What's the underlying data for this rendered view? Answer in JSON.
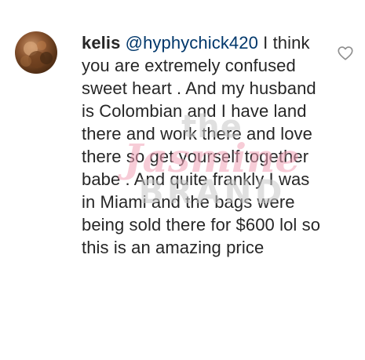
{
  "comment": {
    "username": "kelis",
    "mention": "@hyphychick420",
    "text": " I think you are extremely confused sweet heart . And my husband is Colombian and I have land there and work there and love there so get yourself together babe . And quite frankly I was in Miami and the bags were being sold there for $600 lol so this is an amazing price",
    "like_icon": "heart-outline-icon",
    "avatar_icon": "profile-photo"
  },
  "watermark": {
    "line1": "the",
    "line2": "Jasmine",
    "line3": "BRAND"
  },
  "colors": {
    "text": "#262626",
    "mention": "#00376b",
    "watermark_pink": "#f2a3b8",
    "watermark_gray": "#c8c8c8",
    "icon": "#8e8e8e"
  }
}
